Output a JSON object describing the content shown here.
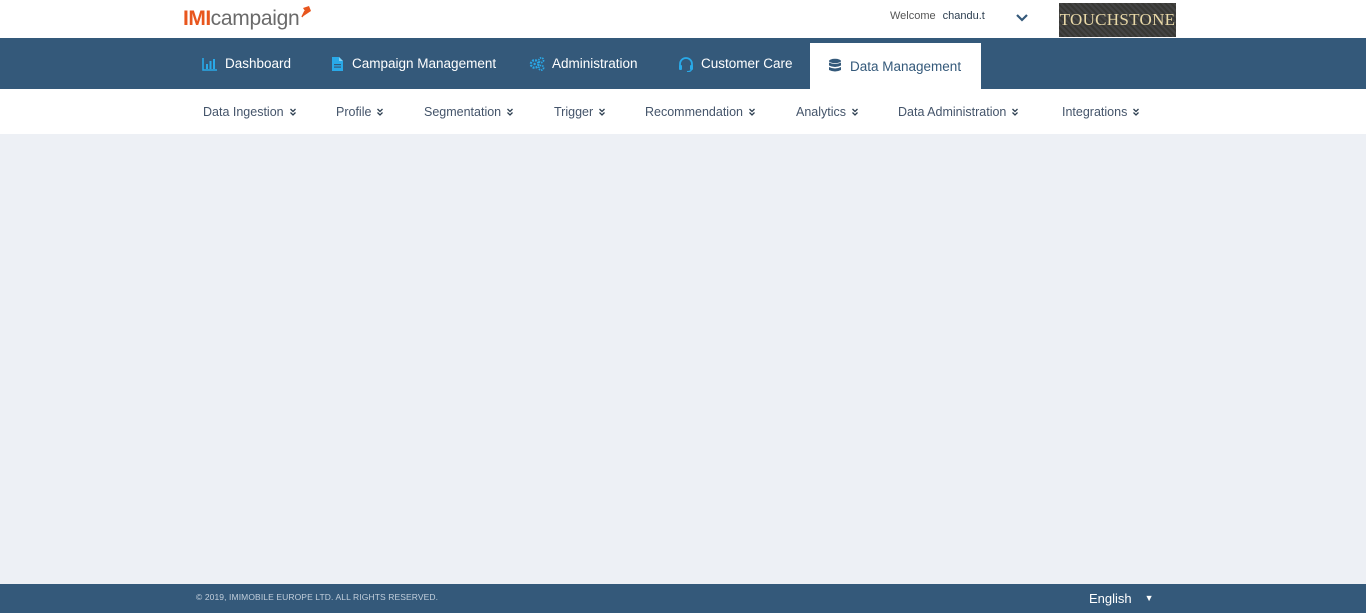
{
  "brand": {
    "logo_part1": "IMI",
    "logo_part2": "campaign"
  },
  "user": {
    "welcome_label": "Welcome",
    "username": "chandu.t"
  },
  "client_logo_text": "TOUCHSTONE",
  "main_nav": [
    {
      "label": "Dashboard",
      "icon": "bar-chart-icon"
    },
    {
      "label": "Campaign Management",
      "icon": "document-icon"
    },
    {
      "label": "Administration",
      "icon": "gears-icon"
    },
    {
      "label": "Customer Care",
      "icon": "headset-icon"
    },
    {
      "label": "Data Management",
      "icon": "database-icon",
      "active": true
    }
  ],
  "sub_nav": [
    {
      "label": "Data Ingestion"
    },
    {
      "label": "Profile"
    },
    {
      "label": "Segmentation"
    },
    {
      "label": "Trigger"
    },
    {
      "label": "Recommendation"
    },
    {
      "label": "Analytics"
    },
    {
      "label": "Data Administration"
    },
    {
      "label": "Integrations"
    }
  ],
  "footer": {
    "copyright": "© 2019, IMIMOBILE EUROPE LTD. ALL RIGHTS RESERVED.",
    "language": "English"
  },
  "colors": {
    "nav_bg": "#34597a",
    "accent_orange": "#e8561e",
    "icon_blue": "#29a9e8",
    "content_bg": "#edf0f5"
  }
}
